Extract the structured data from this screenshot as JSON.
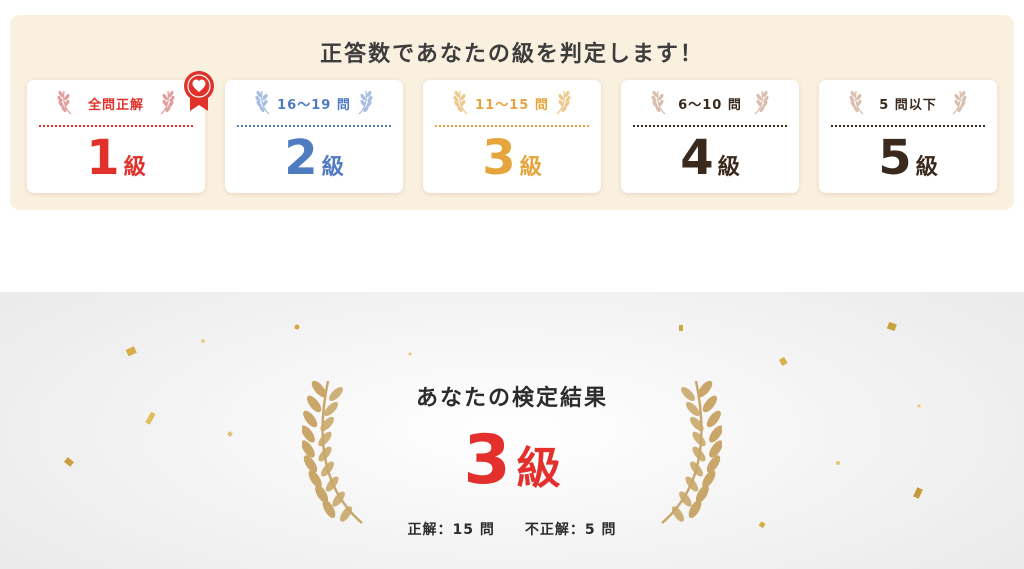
{
  "grade_panel": {
    "heading": "正答数であなたの級を判定します！",
    "cards": [
      {
        "label": "全問正解",
        "grade_number": "1",
        "grade_suffix": "級",
        "color": "#e0322a",
        "laurel_color": "#e0a0a0",
        "divider_color": "#e0322a",
        "badge": "heart-ribbon"
      },
      {
        "label": "16～19 問",
        "grade_number": "2",
        "grade_suffix": "級",
        "color": "#4f7bc1",
        "laurel_color": "#a9bfe1",
        "divider_color": "#4f7bc1"
      },
      {
        "label": "11～15 問",
        "grade_number": "3",
        "grade_suffix": "級",
        "color": "#e6a53c",
        "laurel_color": "#efc98d",
        "divider_color": "#e6a53c"
      },
      {
        "label": "6～10 問",
        "grade_number": "4",
        "grade_suffix": "級",
        "color": "#3a2a1e",
        "laurel_color": "#d9bfae",
        "divider_color": "#3a2a1e"
      },
      {
        "label": "5 問以下",
        "grade_number": "5",
        "grade_suffix": "級",
        "color": "#3a2a1e",
        "laurel_color": "#d9bfae",
        "divider_color": "#3a2a1e"
      }
    ]
  },
  "result": {
    "title": "あなたの検定結果",
    "grade_number": "3",
    "grade_suffix": "級",
    "grade_color": "#e3302c",
    "correct": "正解：15 問",
    "incorrect": "不正解：5 問",
    "laurel_color": "#c9a76a"
  }
}
